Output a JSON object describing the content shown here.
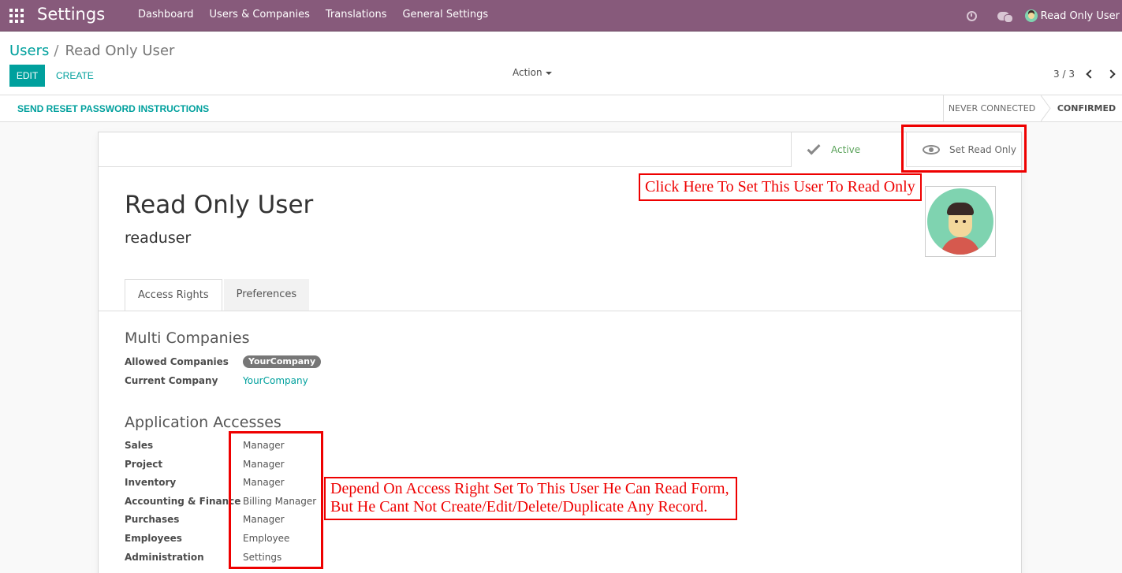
{
  "navbar": {
    "brand": "Settings",
    "menu": [
      "Dashboard",
      "Users & Companies",
      "Translations",
      "General Settings"
    ],
    "user_name": "Read Only User"
  },
  "breadcrumb": {
    "parent": "Users",
    "separator": "/",
    "current": "Read Only User"
  },
  "buttons": {
    "edit": "EDIT",
    "create": "CREATE",
    "action": "Action"
  },
  "pager": {
    "value": "3 / 3"
  },
  "statusbar": {
    "reset": "SEND RESET PASSWORD INSTRUCTIONS",
    "stage_never": "NEVER CONNECTED",
    "stage_confirmed": "CONFIRMED"
  },
  "button_box": {
    "active": "Active",
    "read_only": "Set Read Only"
  },
  "record": {
    "name": "Read Only User",
    "login": "readuser"
  },
  "tabs": [
    "Access Rights",
    "Preferences"
  ],
  "multi_companies": {
    "title": "Multi Companies",
    "allowed_label": "Allowed Companies",
    "allowed_tag": "YourCompany",
    "current_label": "Current Company",
    "current_value": "YourCompany"
  },
  "app_accesses": {
    "title": "Application Accesses",
    "rows": [
      {
        "label": "Sales",
        "value": "Manager"
      },
      {
        "label": "Project",
        "value": "Manager"
      },
      {
        "label": "Inventory",
        "value": "Manager"
      },
      {
        "label": "Accounting & Finance",
        "value": "Billing Manager"
      },
      {
        "label": "Purchases",
        "value": "Manager"
      },
      {
        "label": "Employees",
        "value": "Employee"
      },
      {
        "label": "Administration",
        "value": "Settings"
      }
    ]
  },
  "annotations": {
    "readonly_note": "Click Here To Set This User To Read Only",
    "access_note_line1": "Depend On Access Right Set To This User He Can Read Form,",
    "access_note_line2": "But He Cant Not Create/Edit/Delete/Duplicate Any Record."
  },
  "colors": {
    "navbar": "#875a7b",
    "primary": "#00a09d",
    "annotation": "#e00000"
  }
}
